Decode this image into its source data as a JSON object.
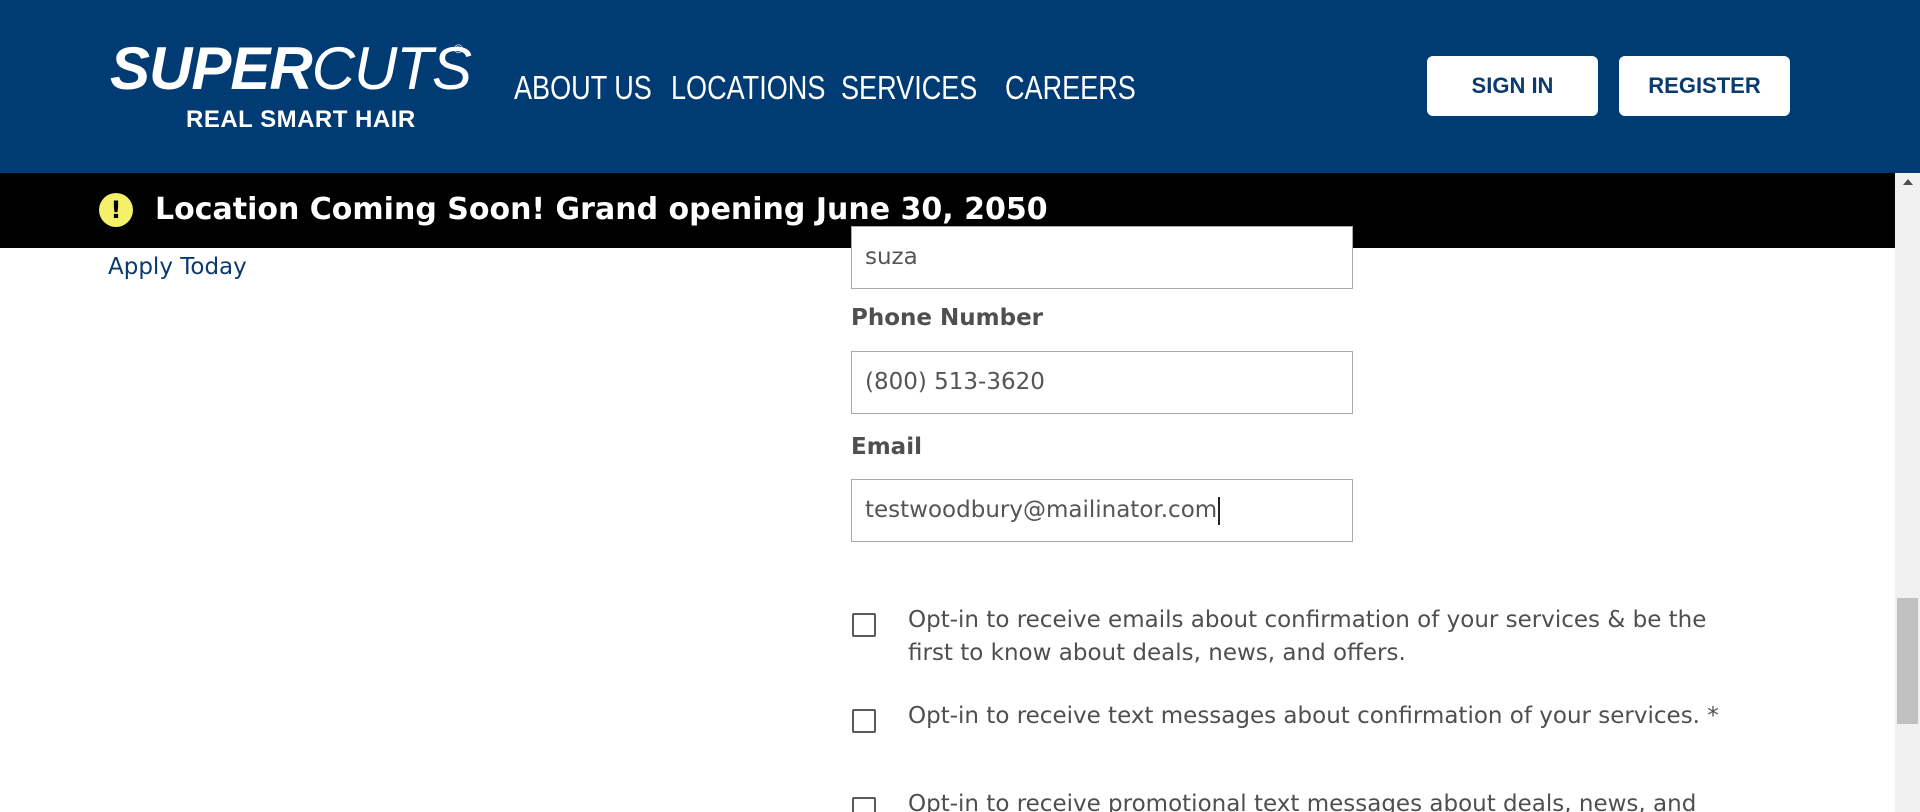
{
  "brand": {
    "logo_bold": "SUPER",
    "logo_light": "CUTS",
    "registered_mark": "®",
    "tagline": "REAL SMART HAIR",
    "header_bg": "#003b73"
  },
  "nav": {
    "items": [
      {
        "label": "ABOUT US"
      },
      {
        "label": "LOCATIONS"
      },
      {
        "label": "SERVICES"
      },
      {
        "label": "CAREERS"
      }
    ]
  },
  "auth": {
    "sign_in_label": "SIGN IN",
    "register_label": "REGISTER"
  },
  "alert": {
    "icon": "exclamation-circle-icon",
    "icon_glyph": "!",
    "message": "Location Coming Soon! Grand opening June 30, 2050",
    "icon_color": "#f5f06a"
  },
  "sidebar": {
    "apply_link": "Apply Today"
  },
  "form": {
    "last_name_value": "suza",
    "phone_label": "Phone Number",
    "phone_value": "(800) 513-3620",
    "email_label": "Email",
    "email_value": "testwoodbury@mailinator.com",
    "optins": [
      {
        "label": "Opt-in to receive emails about confirmation of your services & be the first to know about deals, news, and offers.",
        "checked": false
      },
      {
        "label": "Opt-in to receive text messages about confirmation of your services. *",
        "checked": false
      },
      {
        "label": "Opt-in to receive promotional text messages about deals, news, and",
        "checked": false
      }
    ]
  }
}
